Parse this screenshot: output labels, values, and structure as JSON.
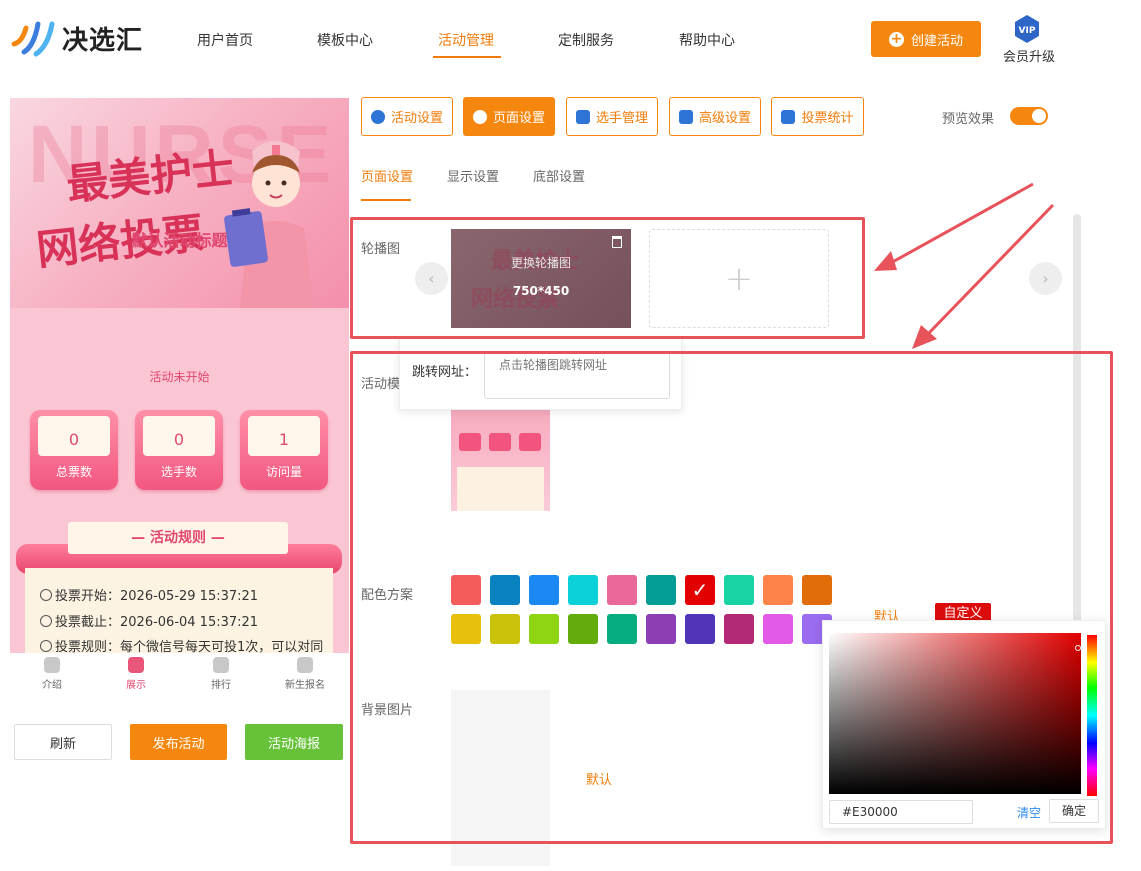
{
  "brand": {
    "name": "决选汇"
  },
  "nav": {
    "items": [
      "用户首页",
      "模板中心",
      "活动管理",
      "定制服务",
      "帮助中心"
    ],
    "active_index": 2
  },
  "header": {
    "create_label": "创建活动",
    "vip_label": "会员升级",
    "vip_badge": "VIP"
  },
  "preview": {
    "banner_bg_text": "NURSE",
    "banner_line1": "最美护士",
    "banner_line2": "网络投票",
    "title": "默认活动标题",
    "status": "活动未开始",
    "stats": [
      {
        "value": "0",
        "label": "总票数"
      },
      {
        "value": "0",
        "label": "选手数"
      },
      {
        "value": "1",
        "label": "访问量"
      }
    ],
    "rules_title": "— 活动规则 —",
    "rules": [
      "投票开始：2026-05-29 15:37:21",
      "投票截止：2026-06-04 15:37:21",
      "投票规则：每个微信号每天可投1次，可以对同"
    ],
    "tabbar": [
      "介绍",
      "展示",
      "排行",
      "新生报名"
    ],
    "tabbar_active": 1
  },
  "actions": {
    "refresh": "刷新",
    "publish": "发布活动",
    "poster": "活动海报"
  },
  "settings_tabs": [
    "活动设置",
    "页面设置",
    "选手管理",
    "高级设置",
    "投票统计"
  ],
  "settings_active": 1,
  "preview_toggle": {
    "label": "预览效果",
    "on": true
  },
  "sub_tabs": [
    "页面设置",
    "显示设置",
    "底部设置"
  ],
  "sub_active": 0,
  "form": {
    "carousel_label": "轮播图",
    "carousel_change": "更换轮播图",
    "carousel_size": "750*450",
    "url_label": "跳转网址：",
    "url_placeholder": "点击轮播图跳转网址",
    "template_label": "活动模",
    "color_label": "配色方案",
    "bg_label": "背景图片",
    "bg_default": "默认",
    "color_default": "默认",
    "color_custom": "自定义"
  },
  "swatches": [
    "#f45b5b",
    "#0a82c1",
    "#1b87f0",
    "#0cd1d9",
    "#e8699a",
    "#049e96",
    "#e30000",
    "#18d4a5",
    "#fe834a",
    "#e06c0a",
    "#e8c00c",
    "#c9c10a",
    "#90d514",
    "#62ac0b",
    "#06ad7e",
    "#8e3eb5",
    "#5134b7",
    "#b22976",
    "#e45ae8",
    "#9a6cf0"
  ],
  "selected_swatch": 6,
  "picker": {
    "hex": "#E30000",
    "clear": "清空",
    "ok": "确定",
    "hue_color": "#e30000"
  },
  "colors": {
    "accent": "#f5870f",
    "annotation": "#e8525a",
    "preview_pink": "#e0476f",
    "poster_green": "#67c23a"
  }
}
